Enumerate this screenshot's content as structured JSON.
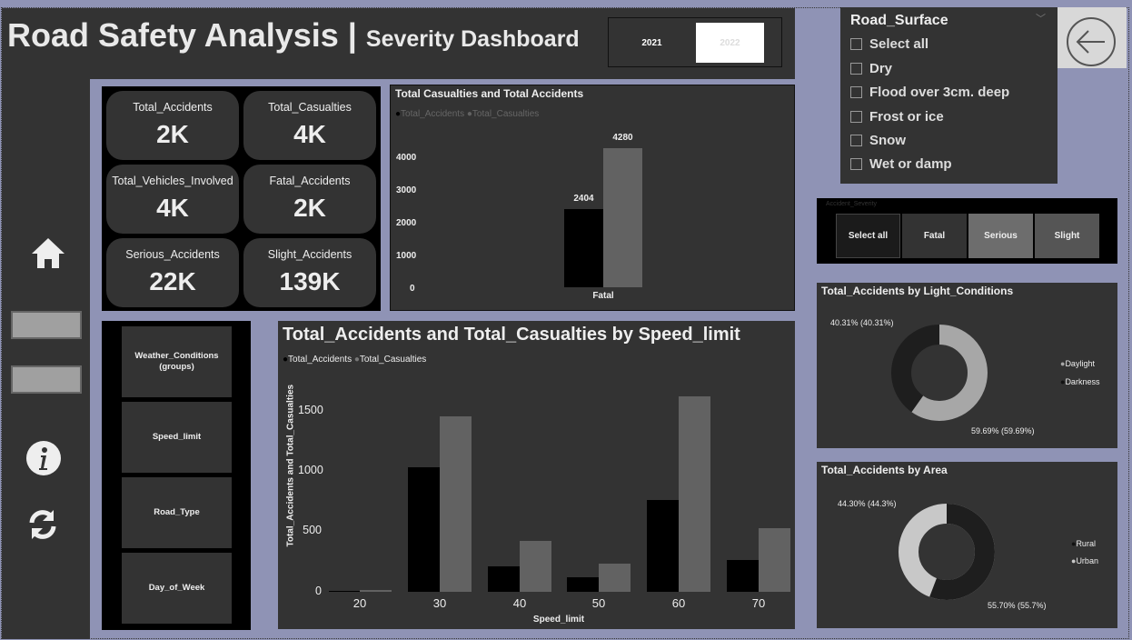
{
  "header": {
    "title": "Road Safety Analysis |",
    "subtitle": "Severity Dashboard"
  },
  "years": [
    {
      "label": "2021",
      "selected": false
    },
    {
      "label": "2022",
      "selected": true
    }
  ],
  "kpis": [
    {
      "label": "Total_Accidents",
      "value": "2K"
    },
    {
      "label": "Total_Casualties",
      "value": "4K"
    },
    {
      "label": "Total_Vehicles_Involved",
      "value": "4K"
    },
    {
      "label": "Fatal_Accidents",
      "value": "2K"
    },
    {
      "label": "Serious_Accidents",
      "value": "22K"
    },
    {
      "label": "Slight_Accidents",
      "value": "139K"
    }
  ],
  "nav_buttons": [
    "Weather_Conditions\n(groups)",
    "Speed_limit",
    "Road_Type",
    "Day_of_Week"
  ],
  "road_surface": {
    "title": "Road_Surface",
    "items": [
      "Select all",
      "Dry",
      "Flood over 3cm. deep",
      "Frost or ice",
      "Snow",
      "Wet or damp"
    ]
  },
  "severity": {
    "title": "Accident_Severity",
    "buttons": [
      "Select all",
      "Fatal",
      "Serious",
      "Slight"
    ]
  },
  "colors": {
    "accidents": "#000000",
    "casualties": "#626262",
    "panel": "#333333",
    "background": "#8f93b5"
  },
  "icons": {
    "home": "home-icon",
    "info": "info-icon",
    "refresh": "refresh-icon",
    "back": "back-arrow-icon"
  },
  "chart_data": [
    {
      "type": "bar",
      "title": "Total Casualties and Total Accidents",
      "categories": [
        "Fatal"
      ],
      "series": [
        {
          "name": "Total_Accidents",
          "values": [
            2404
          ]
        },
        {
          "name": "Total_Casualties",
          "values": [
            4280
          ]
        }
      ],
      "yticks": [
        "4000",
        "3000",
        "2000",
        "1000",
        "0"
      ],
      "ylim": [
        0,
        4000
      ],
      "legend": "top-left"
    },
    {
      "type": "bar",
      "title": "Total_Accidents and Total_Casualties by Speed_limit",
      "xlabel": "Speed_limit",
      "ylabel": "Total_Accidents and Total_Casualties",
      "categories": [
        "20",
        "30",
        "40",
        "50",
        "60",
        "70"
      ],
      "series": [
        {
          "name": "Total_Accidents",
          "values": [
            8,
            1030,
            210,
            120,
            760,
            260
          ]
        },
        {
          "name": "Total_Casualties",
          "values": [
            15,
            1450,
            420,
            230,
            1620,
            530
          ]
        }
      ],
      "yticks": [
        "1500",
        "1000",
        "500",
        "0"
      ],
      "ylim": [
        0,
        1650
      ],
      "legend": "top-left"
    },
    {
      "type": "pie",
      "title": "Total_Accidents by Light_Conditions",
      "slices": [
        {
          "name": "Daylight",
          "value": 59.69,
          "label": "59.69% (59.69%)"
        },
        {
          "name": "Darkness",
          "value": 40.31,
          "label": "40.31% (40.31%)"
        }
      ],
      "legend": "right"
    },
    {
      "type": "pie",
      "title": "Total_Accidents by Area",
      "slices": [
        {
          "name": "Rural",
          "value": 55.7,
          "label": "55.70% (55.7%)"
        },
        {
          "name": "Urban",
          "value": 44.3,
          "label": "44.30% (44.3%)"
        }
      ],
      "legend": "right"
    }
  ]
}
